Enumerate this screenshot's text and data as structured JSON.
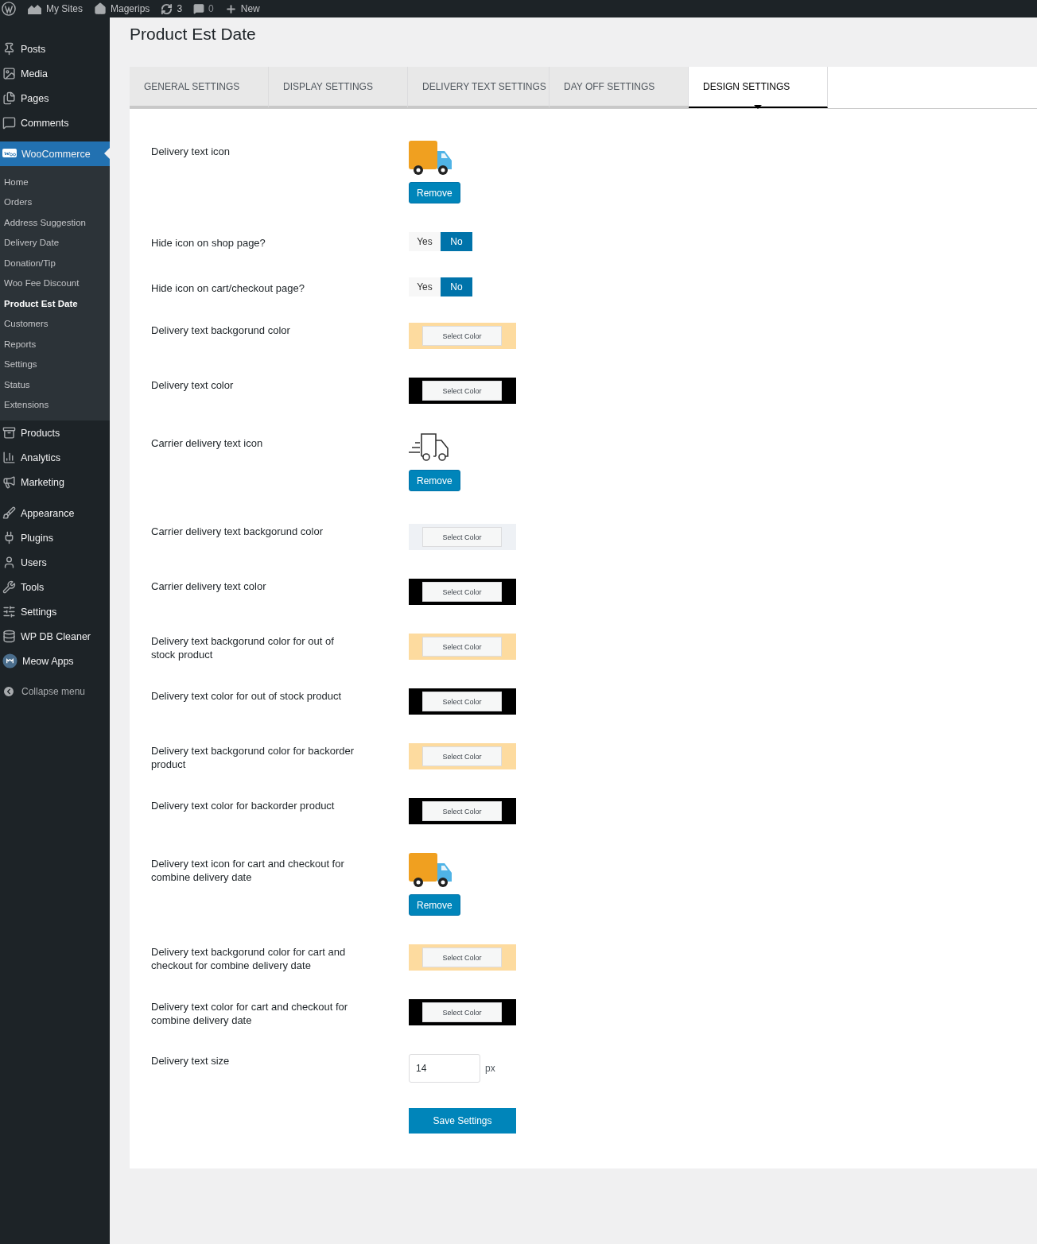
{
  "admin_bar": {
    "items": [
      {
        "kind": "logo"
      },
      {
        "kind": "sites",
        "label": "My Sites"
      },
      {
        "kind": "home",
        "label": "Magerips"
      },
      {
        "kind": "updates",
        "label": "3"
      },
      {
        "kind": "comments",
        "label": "0"
      },
      {
        "kind": "new",
        "label": "New"
      }
    ]
  },
  "sidebar": {
    "groups": [
      [
        {
          "label": "Posts",
          "selected": false
        },
        {
          "label": "Media",
          "selected": false
        },
        {
          "label": "Pages",
          "selected": false
        },
        {
          "label": "Comments",
          "selected": false
        }
      ],
      [
        {
          "label": "WooCommerce",
          "selected": true,
          "children": [
            {
              "label": "Home",
              "selected": false
            },
            {
              "label": "Orders",
              "selected": false
            },
            {
              "label": "Address Suggestion",
              "selected": false
            },
            {
              "label": "Delivery Date",
              "selected": false
            },
            {
              "label": "Donation/Tip",
              "selected": false
            },
            {
              "label": "Woo Fee Discount",
              "selected": false
            },
            {
              "label": "Product Est Date",
              "selected": true
            },
            {
              "label": "Customers",
              "selected": false
            },
            {
              "label": "Reports",
              "selected": false
            },
            {
              "label": "Settings",
              "selected": false
            },
            {
              "label": "Status",
              "selected": false
            },
            {
              "label": "Extensions",
              "selected": false
            }
          ]
        },
        {
          "label": "Products",
          "selected": false
        },
        {
          "label": "Analytics",
          "selected": false
        },
        {
          "label": "Marketing",
          "selected": false
        }
      ],
      [
        {
          "label": "Appearance",
          "selected": false
        },
        {
          "label": "Plugins",
          "selected": false
        },
        {
          "label": "Users",
          "selected": false
        },
        {
          "label": "Tools",
          "selected": false
        },
        {
          "label": "Settings",
          "selected": false
        },
        {
          "label": "WP DB Cleaner",
          "selected": false
        },
        {
          "label": "Meow Apps",
          "selected": false
        }
      ]
    ],
    "collapse": "Collapse menu"
  },
  "page": {
    "title": "Product Est Date"
  },
  "tabs": [
    {
      "label": "GENERAL SETTINGS",
      "selected": false
    },
    {
      "label": "DISPLAY SETTINGS",
      "selected": false
    },
    {
      "label": "DELIVERY TEXT SETTINGS",
      "selected": false
    },
    {
      "label": "DAY OFF SETTINGS",
      "selected": false
    },
    {
      "label": "DESIGN SETTINGS",
      "selected": true
    }
  ],
  "settings": [
    {
      "kind": "icon",
      "label": "Delivery text icon",
      "button": "Remove"
    },
    {
      "kind": "toggle",
      "label": "Hide icon on shop page?",
      "options": [
        {
          "label": "Yes",
          "selected": false
        },
        {
          "label": "No",
          "selected": true
        }
      ]
    },
    {
      "kind": "toggle",
      "label": "Hide icon on cart/checkout page?",
      "options": [
        {
          "label": "Yes",
          "selected": false
        },
        {
          "label": "No",
          "selected": true
        }
      ]
    },
    {
      "kind": "color",
      "label": "Delivery text backgorund color",
      "color": "#fddb9f",
      "button": "Select Color"
    },
    {
      "kind": "color",
      "label": "Delivery text color",
      "color": "#000000",
      "button": "Select Color"
    },
    {
      "kind": "lineicon",
      "label": "Carrier delivery text icon",
      "button": "Remove"
    },
    {
      "kind": "color",
      "label": "Carrier delivery text backgorund color",
      "color": "#eef1f5",
      "button": "Select Color"
    },
    {
      "kind": "color",
      "label": "Carrier delivery text color",
      "color": "#000000",
      "button": "Select Color"
    },
    {
      "kind": "color",
      "label": "Delivery text backgorund color for out of stock product",
      "color": "#fddb9f",
      "button": "Select Color"
    },
    {
      "kind": "color",
      "label": "Delivery text color for out of stock product",
      "color": "#000000",
      "button": "Select Color"
    },
    {
      "kind": "color",
      "label": "Delivery text backgorund color for backorder product",
      "color": "#fddb9f",
      "button": "Select Color"
    },
    {
      "kind": "color",
      "label": "Delivery text color for backorder product",
      "color": "#000000",
      "button": "Select Color"
    },
    {
      "kind": "icon",
      "label": "Delivery text icon for cart and checkout for combine delivery date",
      "button": "Remove"
    },
    {
      "kind": "color",
      "label": "Delivery text backgorund color for cart and checkout for combine delivery date",
      "color": "#fddb9f",
      "button": "Select Color"
    },
    {
      "kind": "color",
      "label": "Delivery text color for cart and checkout for combine delivery date",
      "color": "#000000",
      "button": "Select Color"
    },
    {
      "kind": "size",
      "label": "Delivery text size",
      "value": "14",
      "unit": "px"
    }
  ],
  "save_button": "Save Settings"
}
